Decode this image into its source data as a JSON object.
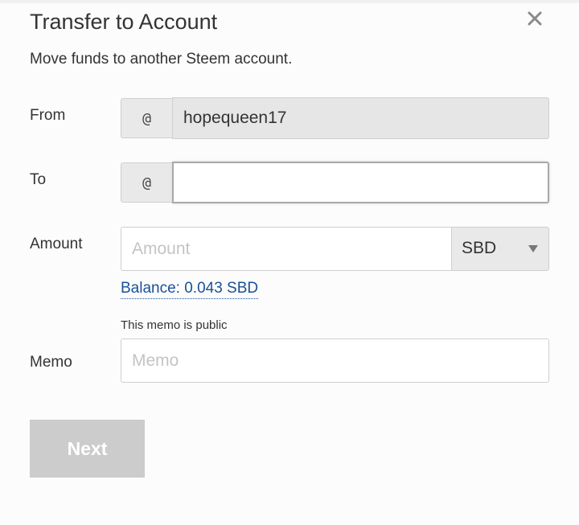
{
  "dialog": {
    "title": "Transfer to Account",
    "subtitle": "Move funds to another Steem account.",
    "close_icon": "close-icon"
  },
  "form": {
    "from": {
      "label": "From",
      "prefix": "@",
      "value": "hopequeen17"
    },
    "to": {
      "label": "To",
      "prefix": "@",
      "value": "",
      "placeholder": ""
    },
    "amount": {
      "label": "Amount",
      "placeholder": "Amount",
      "value": "",
      "asset_selected": "SBD",
      "balance_text": "Balance: 0.043 SBD"
    },
    "memo": {
      "label": "Memo",
      "hint": "This memo is public",
      "placeholder": "Memo",
      "value": ""
    },
    "next_label": "Next"
  },
  "colors": {
    "background": "#fcfcfc",
    "input_addon": "#e9e9e9",
    "disabled_field": "#e6e6e6",
    "link": "#1a5099",
    "button_disabled": "#cccccc",
    "text": "#333333"
  }
}
